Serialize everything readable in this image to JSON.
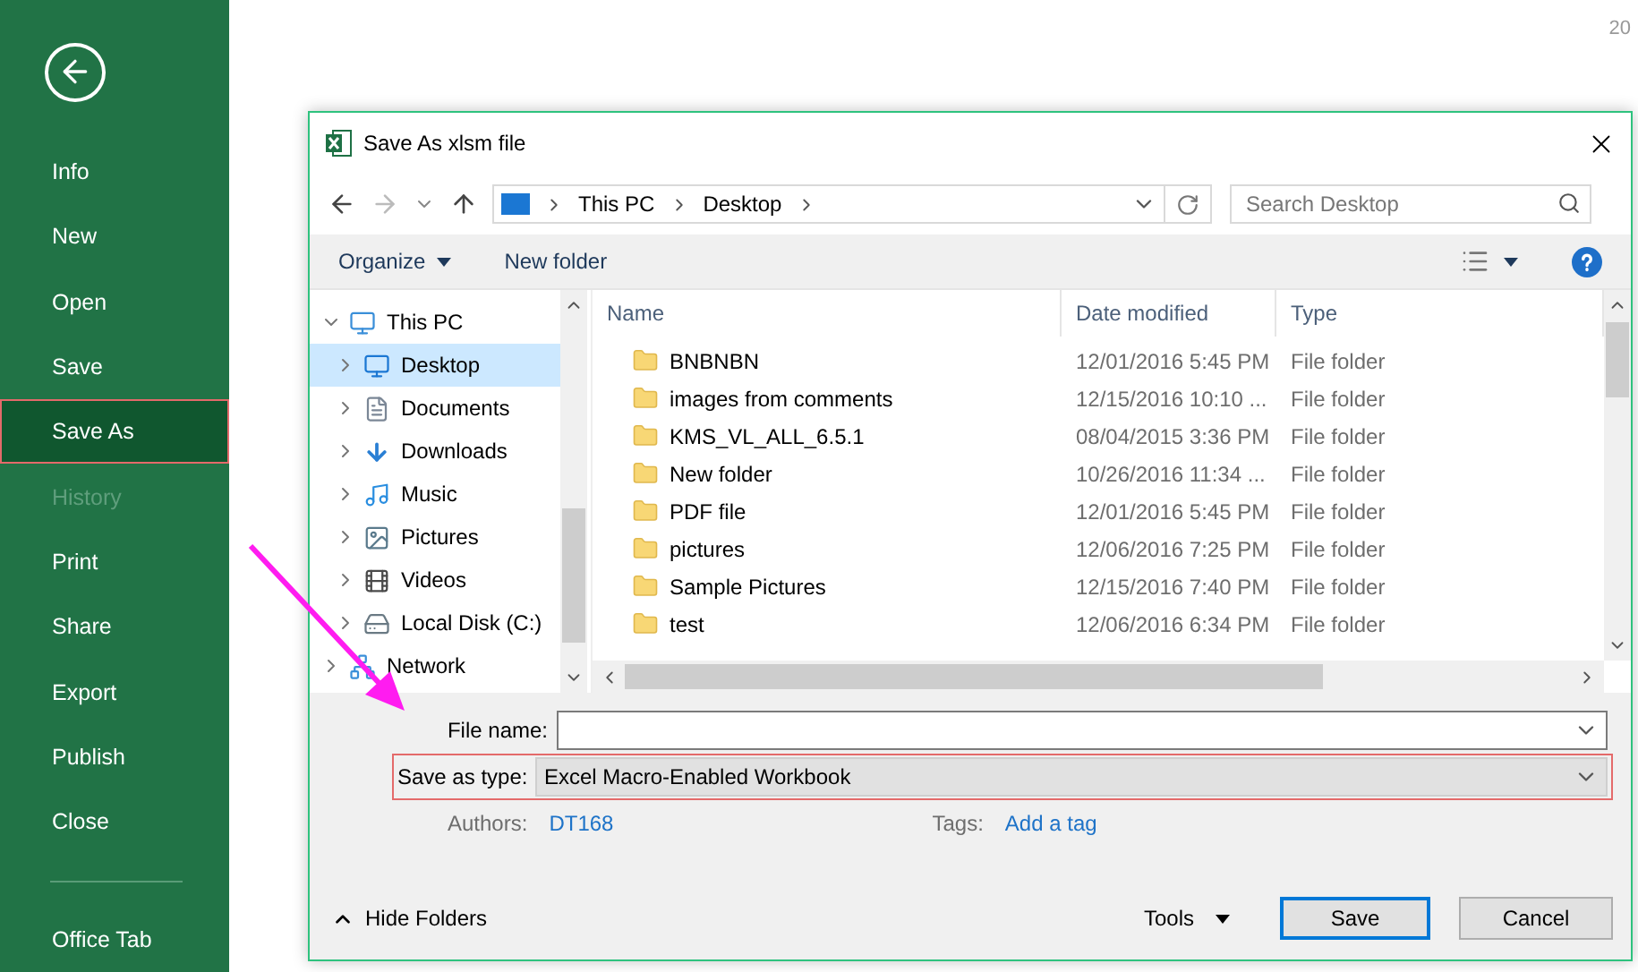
{
  "backstage": {
    "items": [
      {
        "label": "Info",
        "selected": false,
        "disabled": false
      },
      {
        "label": "New",
        "selected": false,
        "disabled": false
      },
      {
        "label": "Open",
        "selected": false,
        "disabled": false
      },
      {
        "label": "Save",
        "selected": false,
        "disabled": false
      },
      {
        "label": "Save As",
        "selected": true,
        "disabled": false
      },
      {
        "label": "History",
        "selected": false,
        "disabled": true
      },
      {
        "label": "Print",
        "selected": false,
        "disabled": false
      },
      {
        "label": "Share",
        "selected": false,
        "disabled": false
      },
      {
        "label": "Export",
        "selected": false,
        "disabled": false
      },
      {
        "label": "Publish",
        "selected": false,
        "disabled": false
      },
      {
        "label": "Close",
        "selected": false,
        "disabled": false
      }
    ],
    "footer_item": "Office Tab"
  },
  "page_number": "20",
  "dialog": {
    "title": "Save As xlsm file",
    "breadcrumb": [
      "This PC",
      "Desktop"
    ],
    "search": {
      "placeholder": "Search Desktop"
    },
    "toolbar": [
      "Organize",
      "New folder"
    ],
    "nav_tree": [
      {
        "label": "This PC",
        "kind": "pc",
        "expanded": true,
        "selected": false,
        "children": [
          {
            "label": "Desktop",
            "kind": "desktop",
            "expanded": false,
            "selected": true
          },
          {
            "label": "Documents",
            "kind": "documents",
            "expanded": false,
            "selected": false
          },
          {
            "label": "Downloads",
            "kind": "downloads",
            "expanded": false,
            "selected": false
          },
          {
            "label": "Music",
            "kind": "music",
            "expanded": false,
            "selected": false
          },
          {
            "label": "Pictures",
            "kind": "pictures",
            "expanded": false,
            "selected": false
          },
          {
            "label": "Videos",
            "kind": "videos",
            "expanded": false,
            "selected": false
          },
          {
            "label": "Local Disk (C:)",
            "kind": "disk",
            "expanded": false,
            "selected": false
          }
        ]
      },
      {
        "label": "Network",
        "kind": "network",
        "expanded": false,
        "selected": false
      }
    ],
    "table": {
      "columns": [
        "Name",
        "Date modified",
        "Type"
      ],
      "rows": [
        {
          "name": "BNBNBN",
          "date": "12/01/2016 5:45 PM",
          "type": "File folder"
        },
        {
          "name": "images from comments",
          "date": "12/15/2016 10:10 ...",
          "type": "File folder"
        },
        {
          "name": "KMS_VL_ALL_6.5.1",
          "date": "08/04/2015 3:36 PM",
          "type": "File folder"
        },
        {
          "name": "New folder",
          "date": "10/26/2016 11:34 ...",
          "type": "File folder"
        },
        {
          "name": "PDF file",
          "date": "12/01/2016 5:45 PM",
          "type": "File folder"
        },
        {
          "name": "pictures",
          "date": "12/06/2016 7:25 PM",
          "type": "File folder"
        },
        {
          "name": "Sample Pictures",
          "date": "12/15/2016 7:40 PM",
          "type": "File folder"
        },
        {
          "name": "test",
          "date": "12/06/2016 6:34 PM",
          "type": "File folder"
        }
      ]
    },
    "file_name": {
      "label": "File name:"
    },
    "save_as_type": {
      "label": "Save as type:",
      "value": "Excel Macro-Enabled Workbook",
      "highlighted": true
    },
    "authors": {
      "label": "Authors:",
      "value": "DT168"
    },
    "tags": {
      "label": "Tags:",
      "value": "Add a tag"
    },
    "hide_folders": "Hide Folders",
    "buttons": [
      {
        "label": "Tools",
        "kind": "menu"
      },
      {
        "label": "Save",
        "kind": "default"
      },
      {
        "label": "Cancel",
        "kind": "plain"
      }
    ]
  }
}
